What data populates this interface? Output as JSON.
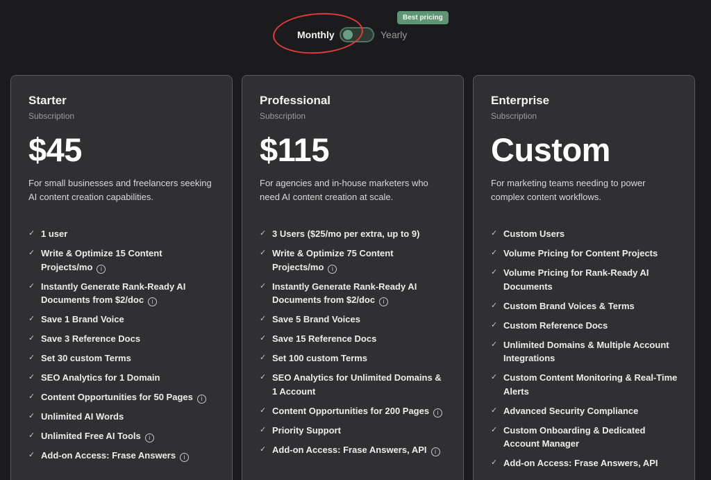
{
  "toggle": {
    "monthly_label": "Monthly",
    "yearly_label": "Yearly",
    "badge": "Best pricing",
    "selected": "Monthly"
  },
  "colors": {
    "background": "#1b1b1d",
    "card": "#303033",
    "badge": "#5f9574",
    "annotation": "#e03a3a"
  },
  "plans": [
    {
      "name": "Starter",
      "type": "Subscription",
      "price": "$45",
      "description": "For small businesses and freelancers seeking AI content creation capabilities.",
      "features": [
        {
          "text": "1 user",
          "info": false
        },
        {
          "text": "Write & Optimize 15 Content Projects/mo",
          "info": true
        },
        {
          "text": "Instantly Generate Rank-Ready AI Documents from $2/doc",
          "info": true
        },
        {
          "text": "Save 1 Brand Voice",
          "info": false
        },
        {
          "text": "Save 3 Reference Docs",
          "info": false
        },
        {
          "text": "Set 30 custom Terms",
          "info": false
        },
        {
          "text": "SEO Analytics for 1 Domain",
          "info": false
        },
        {
          "text": "Content Opportunities for 50 Pages",
          "info": true
        },
        {
          "text": "Unlimited AI Words",
          "info": false
        },
        {
          "text": "Unlimited Free AI Tools",
          "info": true
        },
        {
          "text": "Add-on Access: Frase Answers",
          "info": true
        }
      ]
    },
    {
      "name": "Professional",
      "type": "Subscription",
      "price": "$115",
      "description": "For agencies and in-house marketers who need AI content creation at scale.",
      "features": [
        {
          "text": "3 Users ($25/mo per extra, up to 9)",
          "info": false
        },
        {
          "text": "Write & Optimize 75 Content Projects/mo",
          "info": true
        },
        {
          "text": "Instantly Generate Rank-Ready AI Documents from $2/doc",
          "info": true
        },
        {
          "text": "Save 5 Brand Voices",
          "info": false
        },
        {
          "text": "Save 15 Reference Docs",
          "info": false
        },
        {
          "text": "Set 100 custom Terms",
          "info": false
        },
        {
          "text": "SEO Analytics for Unlimited Domains & 1 Account",
          "info": false
        },
        {
          "text": "Content Opportunities for 200 Pages",
          "info": true
        },
        {
          "text": "Priority Support",
          "info": false
        },
        {
          "text": "Add-on Access: Frase Answers, API",
          "info": true
        }
      ]
    },
    {
      "name": "Enterprise",
      "type": "Subscription",
      "price": "Custom",
      "description": "For marketing teams needing to power complex content workflows.",
      "features": [
        {
          "text": "Custom Users",
          "info": false
        },
        {
          "text": "Volume Pricing for Content Projects",
          "info": false
        },
        {
          "text": "Volume Pricing for Rank-Ready AI Documents",
          "info": false
        },
        {
          "text": "Custom Brand Voices & Terms",
          "info": false
        },
        {
          "text": "Custom Reference Docs",
          "info": false
        },
        {
          "text": "Unlimited Domains & Multiple Account Integrations",
          "info": false
        },
        {
          "text": "Custom Content Monitoring & Real-Time Alerts",
          "info": false
        },
        {
          "text": "Advanced Security Compliance",
          "info": false
        },
        {
          "text": "Custom Onboarding & Dedicated Account Manager",
          "info": false
        },
        {
          "text": "Add-on Access: Frase Answers, API",
          "info": false
        }
      ]
    }
  ]
}
